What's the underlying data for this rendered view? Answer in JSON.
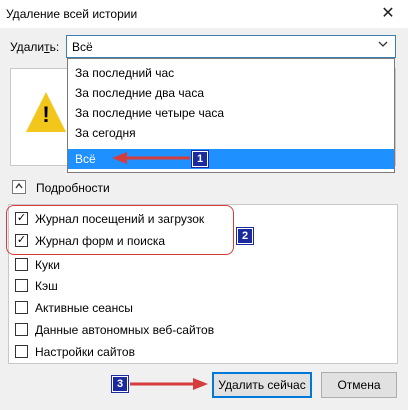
{
  "window": {
    "title": "Удаление всей истории",
    "close_glyph": "✕"
  },
  "delete": {
    "label_prefix": "Удали",
    "label_underlined": "т",
    "label_suffix": "ь:",
    "selected": "Всё",
    "options": [
      "За последний час",
      "За последние два часа",
      "За последние четыре часа",
      "За сегодня",
      "Всё"
    ],
    "selected_index": 4
  },
  "details": {
    "label": "Подробности",
    "expanded": true,
    "toggle_glyph": "⌃"
  },
  "items": [
    {
      "label": "Журнал посещений и загрузок",
      "checked": true
    },
    {
      "label": "Журнал форм и поиска",
      "checked": true
    },
    {
      "label": "Куки",
      "checked": false
    },
    {
      "label": "Кэш",
      "checked": false
    },
    {
      "label": "Активные сеансы",
      "checked": false
    },
    {
      "label": "Данные автономных веб-сайтов",
      "checked": false
    },
    {
      "label": "Настройки сайтов",
      "checked": false
    }
  ],
  "buttons": {
    "clear_now": "Удалить сейчас",
    "cancel": "Отмена"
  },
  "annotations": {
    "badges": [
      "1",
      "2",
      "3"
    ]
  },
  "colors": {
    "annotation_red": "#d53c3c",
    "badge_blue": "#1b2a9f",
    "highlight": "#1e90ff",
    "focus_border": "#0078d7"
  },
  "icons": {
    "warning": "warning-icon",
    "close": "close-icon",
    "dropdown": "chevron-down-icon",
    "collapse": "chevron-up-icon"
  }
}
